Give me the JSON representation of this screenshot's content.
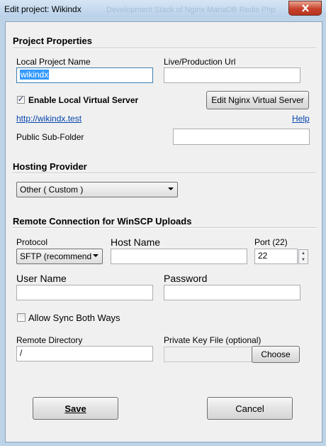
{
  "window": {
    "title": "Edit project: Wikindx",
    "background_title": "Development Stack of Nginx MariaDB Redis Php"
  },
  "project_properties": {
    "heading": "Project Properties",
    "local_name_label": "Local Project Name",
    "local_name_value": "wikindx",
    "live_url_label": "Live/Production Url",
    "live_url_value": "",
    "enable_server_label": "Enable Local Virtual Server",
    "enable_server_checked": true,
    "edit_nginx_label": "Edit Nginx Virtual Server",
    "local_url": "http://wikindx.test",
    "help_label": "Help",
    "subfolder_label": "Public Sub-Folder",
    "subfolder_value": ""
  },
  "hosting": {
    "heading": "Hosting Provider",
    "selected": "Other ( Custom )"
  },
  "remote": {
    "heading": "Remote Connection for WinSCP Uploads",
    "protocol_label": "Protocol",
    "protocol_value": "SFTP (recommend",
    "host_label": "Host Name",
    "host_value": "",
    "port_label": "Port (22)",
    "port_value": "22",
    "user_label": "User Name",
    "user_value": "",
    "password_label": "Password",
    "password_value": "",
    "sync_label": "Allow Sync Both Ways",
    "sync_checked": false,
    "remote_dir_label": "Remote Directory",
    "remote_dir_value": "/",
    "key_label": "Private Key File (optional)",
    "key_value": "",
    "choose_label": "Choose"
  },
  "actions": {
    "save": "Save",
    "cancel": "Cancel"
  },
  "colors": {
    "selection": "#3399ff",
    "link": "#0645ad",
    "close": "#c7422c"
  },
  "icons": {
    "close": "close-icon",
    "dropdown": "chevron-down-icon",
    "spin_up": "arrow-up-icon",
    "spin_down": "arrow-down-icon",
    "check": "checkmark-icon"
  }
}
